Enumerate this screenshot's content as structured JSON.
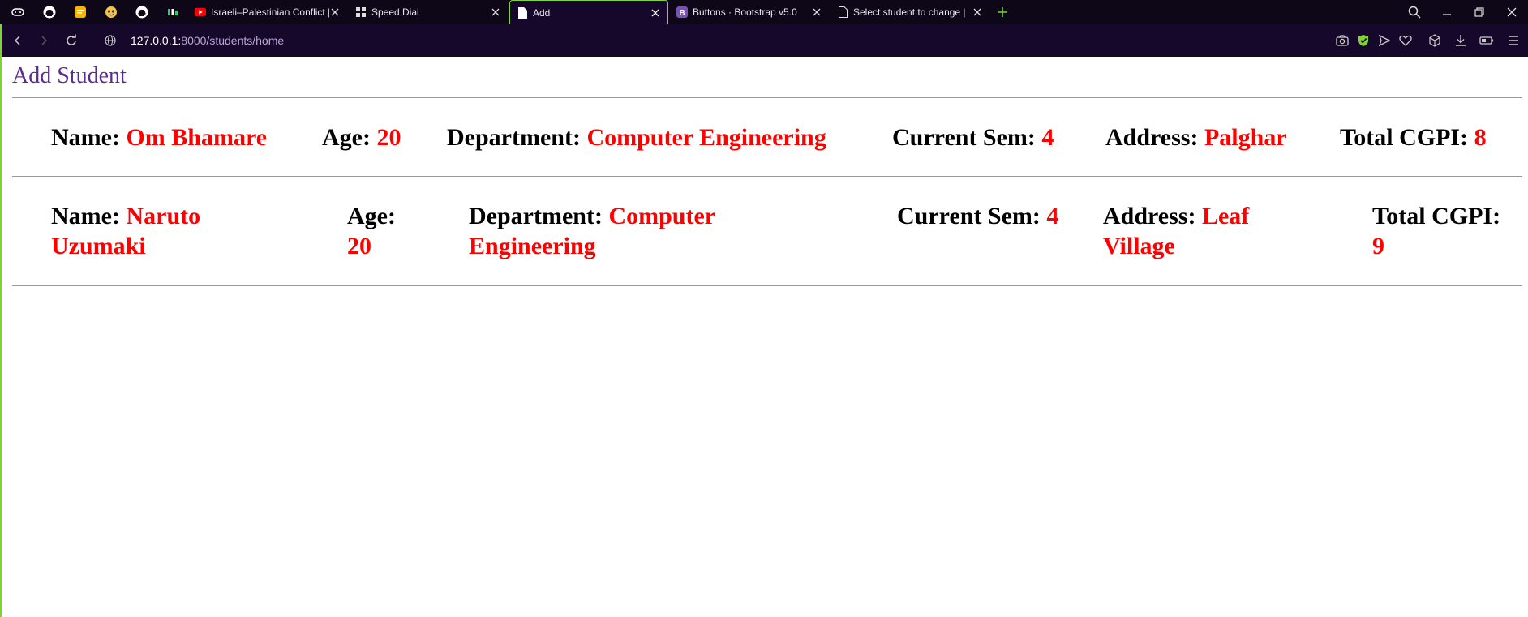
{
  "browser": {
    "tabs": [
      {
        "title": "Israeli–Palestinian Conflict |"
      },
      {
        "title": "Speed Dial"
      },
      {
        "title": "Add"
      },
      {
        "title": "Buttons · Bootstrap v5.0"
      },
      {
        "title": "Select student to change |"
      }
    ],
    "url_host": "127.0.0.1:",
    "url_rest": "8000/students/home"
  },
  "page": {
    "title": "Add Student",
    "labels": {
      "name": "Name:",
      "age": "Age:",
      "department": "Department:",
      "sem": "Current Sem:",
      "address": "Address:",
      "cgpi": "Total CGPI:"
    },
    "students": [
      {
        "name": "Om Bhamare",
        "age": "20",
        "department": "Computer Engineering",
        "sem": "4",
        "address": "Palghar",
        "cgpi": "8"
      },
      {
        "name": "Naruto Uzumaki",
        "age": "20",
        "department": "Computer Engineering",
        "sem": "4",
        "address": "Leaf Village",
        "cgpi": "9"
      }
    ]
  },
  "colors": {
    "accent": "#7fd332",
    "title": "#5b2c8f",
    "value": "#ff0000"
  }
}
